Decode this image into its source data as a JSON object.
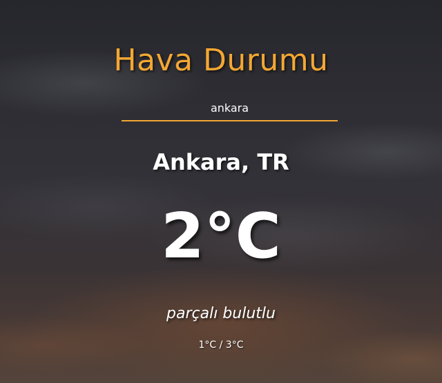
{
  "app": {
    "title": "Hava Durumu"
  },
  "search": {
    "value": "ankara"
  },
  "weather": {
    "location": "Ankara, TR",
    "temperature": "2°C",
    "description": "parçalı bulutlu",
    "min_max": "1°C / 3°C"
  },
  "colors": {
    "accent": "#f4a733",
    "text": "#ffffff"
  }
}
